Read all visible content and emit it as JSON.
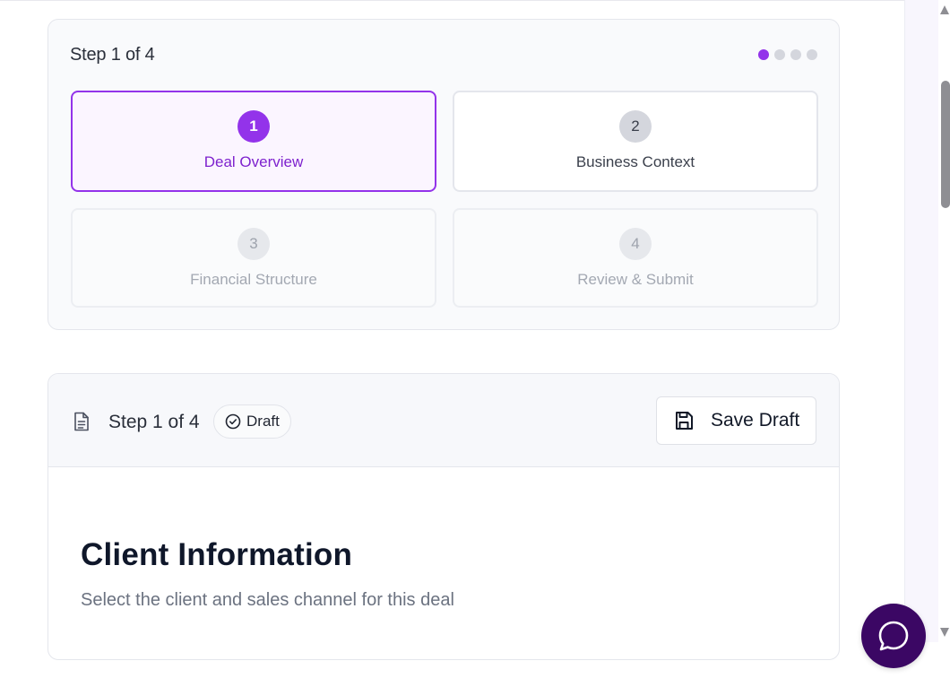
{
  "stepper": {
    "title": "Step 1 of 4",
    "current_step": 1,
    "total_steps": 4,
    "steps": [
      {
        "number": "1",
        "label": "Deal Overview",
        "state": "active"
      },
      {
        "number": "2",
        "label": "Business Context",
        "state": "available"
      },
      {
        "number": "3",
        "label": "Financial Structure",
        "state": "disabled"
      },
      {
        "number": "4",
        "label": "Review & Submit",
        "state": "disabled"
      }
    ]
  },
  "form": {
    "header_step": "Step 1 of 4",
    "status_badge": "Draft",
    "save_label": "Save Draft",
    "section_title": "Client Information",
    "section_subtitle": "Select the client and sales channel for this deal"
  },
  "icons": {
    "doc": "document-icon",
    "badge": "check-circle-icon",
    "save": "floppy-disk-icon",
    "chat": "chat-bubble-icon"
  },
  "colors": {
    "accent": "#9333ea",
    "accent_text": "#7e22ce",
    "chat_fab": "#3b0764"
  }
}
